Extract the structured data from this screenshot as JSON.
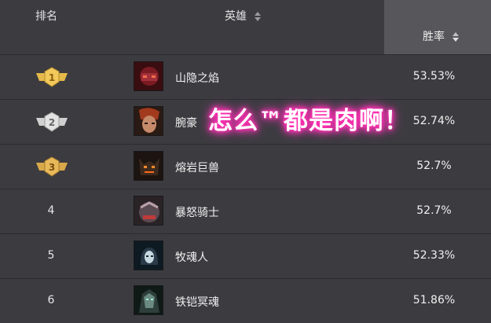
{
  "header": {
    "rank_label": "排名",
    "hero_label": "英雄",
    "winrate_label": "胜率"
  },
  "rows": [
    {
      "rank": "1",
      "medal": "gold",
      "hero": "山隐之焰",
      "winrate": "53.53%"
    },
    {
      "rank": "2",
      "medal": "silver",
      "hero": "腕豪",
      "winrate": "52.74%"
    },
    {
      "rank": "3",
      "medal": "bronze",
      "hero": "熔岩巨兽",
      "winrate": "52.7%"
    },
    {
      "rank": "4",
      "medal": "",
      "hero": "暴怒骑士",
      "winrate": "52.7%"
    },
    {
      "rank": "5",
      "medal": "",
      "hero": "牧魂人",
      "winrate": "52.33%"
    },
    {
      "rank": "6",
      "medal": "",
      "hero": "铁铠冥魂",
      "winrate": "51.86%"
    }
  ],
  "overlay_text": "怎么™都是肉啊！",
  "colors": {
    "gold": "#e5b94a",
    "silver": "#d0d0d0",
    "bronze": "#d9a84a",
    "glow": "#ff2fb0"
  }
}
